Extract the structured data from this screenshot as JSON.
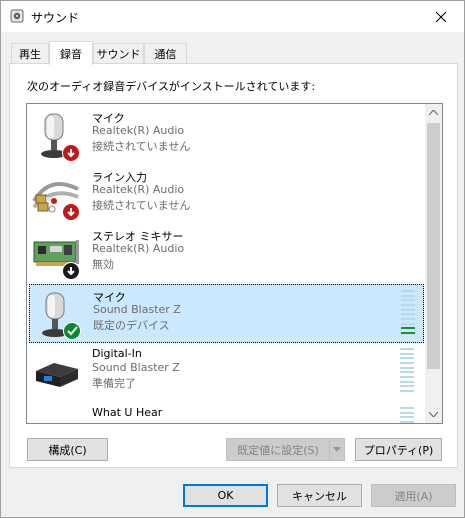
{
  "window": {
    "title": "サウンド",
    "icon": "speaker-icon",
    "close_icon": "close-icon"
  },
  "tabs": [
    {
      "label": "再生",
      "active": false
    },
    {
      "label": "録音",
      "active": true
    },
    {
      "label": "サウンド",
      "active": false
    },
    {
      "label": "通信",
      "active": false
    }
  ],
  "recording": {
    "description": "次のオーディオ録音デバイスがインストールされています:",
    "devices": [
      {
        "name": "マイク",
        "driver": "Realtek(R) Audio",
        "status": "接続されていません",
        "icon": "microphone-icon",
        "overlay": "down-arrow-red",
        "selected": false
      },
      {
        "name": "ライン入力",
        "driver": "Realtek(R) Audio",
        "status": "接続されていません",
        "icon": "rca-cable-icon",
        "overlay": "down-arrow-red",
        "selected": false
      },
      {
        "name": "ステレオ ミキサー",
        "driver": "Realtek(R) Audio",
        "status": "無効",
        "icon": "sound-card-icon",
        "overlay": "down-arrow-black",
        "selected": false
      },
      {
        "name": "マイク",
        "driver": "Sound Blaster Z",
        "status": "既定のデバイス",
        "icon": "microphone-icon",
        "overlay": "check-green",
        "selected": true
      },
      {
        "name": "Digital-In",
        "driver": "Sound Blaster Z",
        "status": "準備完了",
        "icon": "digital-in-icon",
        "overlay": "",
        "selected": false
      },
      {
        "name": "What U Hear",
        "driver": "",
        "status": "",
        "icon": "",
        "overlay": "",
        "selected": false
      }
    ]
  },
  "buttons": {
    "configure": "構成(C)",
    "set_default": "既定値に設定(S)",
    "properties": "プロパティ(P)",
    "ok": "OK",
    "cancel": "キャンセル",
    "apply": "適用(A)"
  },
  "colors": {
    "selection": "#cce8ff",
    "meter_idle": "#b5dbe8",
    "meter_active": "#1e8c32",
    "default_button_border": "#0078d7"
  }
}
